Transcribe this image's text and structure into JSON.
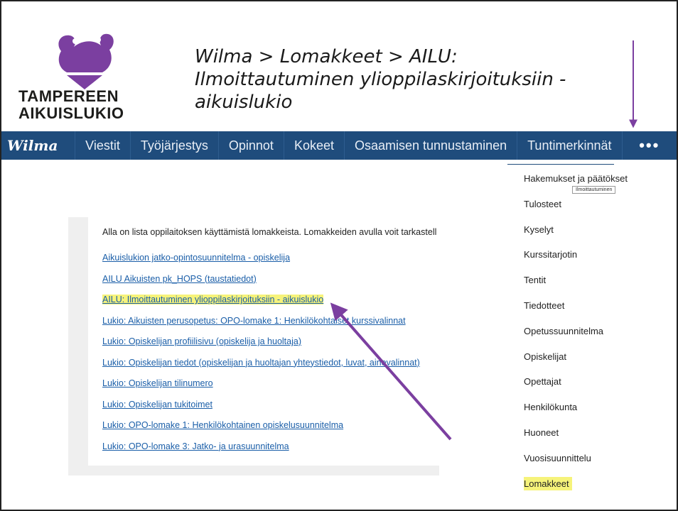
{
  "logo": {
    "line1": "TAMPEREEN",
    "line2": "AIKUISLUKIO",
    "brand_color": "#7b3fa0",
    "icon": "tampere-mascot-logo"
  },
  "title": {
    "line1": "Wilma > Lomakkeet > AILU:",
    "line2": "Ilmoittautuminen ylioppilaskirjoituksiin -",
    "line3": "aikuislukio"
  },
  "navbar": {
    "brand": "Wilma",
    "bg_color": "#1f4c7c",
    "items": [
      "Viestit",
      "Työjärjestys",
      "Opinnot",
      "Kokeet",
      "Osaamisen tunnustaminen",
      "Tuntimerkinnät"
    ],
    "more": "•••"
  },
  "content": {
    "intro": "Alla on lista oppilaitoksen käyttämistä lomakkeista. Lomakkeiden avulla voit tarkastell",
    "links": [
      "Aikuislukion jatko-opintosuunnitelma - opiskelija",
      "AILU Aikuisten pk_HOPS (taustatiedot)",
      "AILU: Ilmoittautuminen ylioppilaskirjoituksiin - aikuislukio",
      "Lukio: Aikuisten perusopetus: OPO-lomake 1: Henkilökohtaiset kurssivalinnat",
      "Lukio: Opiskelijan profiilisivu (opiskelija ja huoltaja)",
      "Lukio: Opiskelijan tiedot (opiskelijan ja huoltajan yhteystiedot, luvat, ainevalinnat)",
      "Lukio: Opiskelijan tilinumero",
      "Lukio: Opiskelijan tukitoimet",
      "Lukio: OPO-lomake 1: Henkilökohtainen opiskelusuunnitelma",
      "Lukio: OPO-lomake 3: Jatko- ja urasuunnitelma"
    ],
    "highlight_color": "#f6f37a"
  },
  "menu": {
    "items": [
      "Hakemukset ja päätökset",
      "Tulosteet",
      "Kyselyt",
      "Kurssitarjotin",
      "Tentit",
      "Tiedotteet",
      "Opetussuunnitelma",
      "Opiskelijat",
      "Opettajat",
      "Henkilökunta",
      "Huoneet",
      "Vuosisuunnittelu",
      "Lomakkeet"
    ],
    "tooltip": "Ilmoittautuminen"
  },
  "annotations": {
    "arrow_color": "#7b3fa0"
  }
}
